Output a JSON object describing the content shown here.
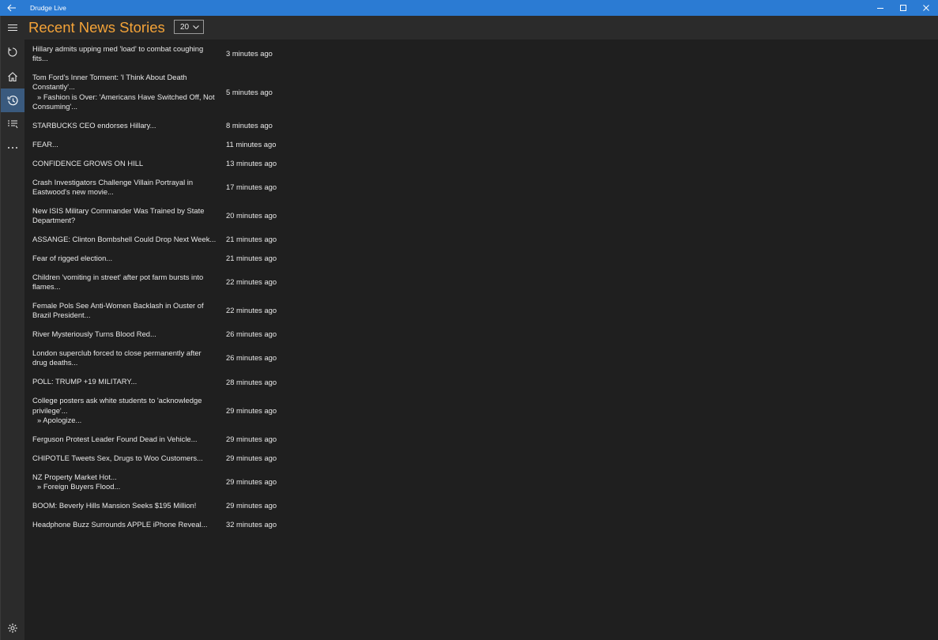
{
  "window": {
    "title": "Drudge Live",
    "icons": {
      "back": "back-arrow-icon",
      "minimize": "minimize-icon",
      "maximize": "maximize-icon",
      "close": "close-icon"
    }
  },
  "sidebar": {
    "items": [
      {
        "name": "menu",
        "icon": "hamburger-icon"
      },
      {
        "name": "refresh",
        "icon": "refresh-icon"
      },
      {
        "name": "home",
        "icon": "home-icon"
      },
      {
        "name": "recent",
        "icon": "history-icon",
        "selected": true
      },
      {
        "name": "list",
        "icon": "list-icon"
      },
      {
        "name": "more",
        "icon": "more-icon"
      },
      {
        "name": "settings",
        "icon": "gear-icon"
      }
    ]
  },
  "header": {
    "title": "Recent News Stories",
    "count_selected": "20"
  },
  "colors": {
    "titlebar": "#2b7bd3",
    "accent": "#f4a338",
    "background": "#1f1f1f",
    "panel": "#2b2b2b",
    "selected": "#3a5a7e"
  },
  "stories": [
    {
      "lines": [
        "Hillary admits upping med 'load' to combat coughing",
        "fits..."
      ],
      "time": "3 minutes ago"
    },
    {
      "lines": [
        "Tom Ford's Inner Torment: 'I Think About Death",
        "Constantly'...",
        "» Fashion is Over:  'Americans Have Switched Off, Not",
        "Consuming'..."
      ],
      "time": "5 minutes ago"
    },
    {
      "lines": [
        "STARBUCKS CEO endorses Hillary..."
      ],
      "time": "8 minutes ago"
    },
    {
      "lines": [
        "FEAR..."
      ],
      "time": "11 minutes ago"
    },
    {
      "lines": [
        "CONFIDENCE GROWS ON HILL"
      ],
      "time": "13 minutes ago"
    },
    {
      "lines": [
        "Crash Investigators Challenge Villain Portrayal in",
        "Eastwood's new movie..."
      ],
      "time": "17 minutes ago"
    },
    {
      "lines": [
        "New ISIS Military Commander Was Trained by State",
        "Department?"
      ],
      "time": "20 minutes ago"
    },
    {
      "lines": [
        "ASSANGE: Clinton Bombshell Could Drop Next Week..."
      ],
      "time": "21 minutes ago"
    },
    {
      "lines": [
        "Fear of rigged election..."
      ],
      "time": "21 minutes ago"
    },
    {
      "lines": [
        "Children 'vomiting in street' after pot farm bursts into",
        "flames..."
      ],
      "time": "22 minutes ago"
    },
    {
      "lines": [
        "Female Pols See Anti-Women Backlash in Ouster of",
        "Brazil President..."
      ],
      "time": "22 minutes ago"
    },
    {
      "lines": [
        "River Mysteriously Turns Blood Red..."
      ],
      "time": "26 minutes ago"
    },
    {
      "lines": [
        "London superclub forced to close permanently after",
        "drug deaths..."
      ],
      "time": "26 minutes ago"
    },
    {
      "lines": [
        "POLL: TRUMP +19 MILITARY..."
      ],
      "time": "28 minutes ago"
    },
    {
      "lines": [
        "College posters ask white students to 'acknowledge",
        "privilege'...",
        "» Apologize..."
      ],
      "time": "29 minutes ago"
    },
    {
      "lines": [
        "Ferguson Protest Leader Found Dead in Vehicle..."
      ],
      "time": "29 minutes ago"
    },
    {
      "lines": [
        "CHIPOTLE Tweets Sex, Drugs to Woo Customers..."
      ],
      "time": "29 minutes ago"
    },
    {
      "lines": [
        "NZ Property Market Hot...",
        "» Foreign Buyers Flood..."
      ],
      "time": "29 minutes ago"
    },
    {
      "lines": [
        "BOOM: Beverly Hills Mansion Seeks $195 Million!"
      ],
      "time": "29 minutes ago"
    },
    {
      "lines": [
        "Headphone Buzz Surrounds APPLE iPhone Reveal..."
      ],
      "time": "32 minutes ago"
    }
  ]
}
